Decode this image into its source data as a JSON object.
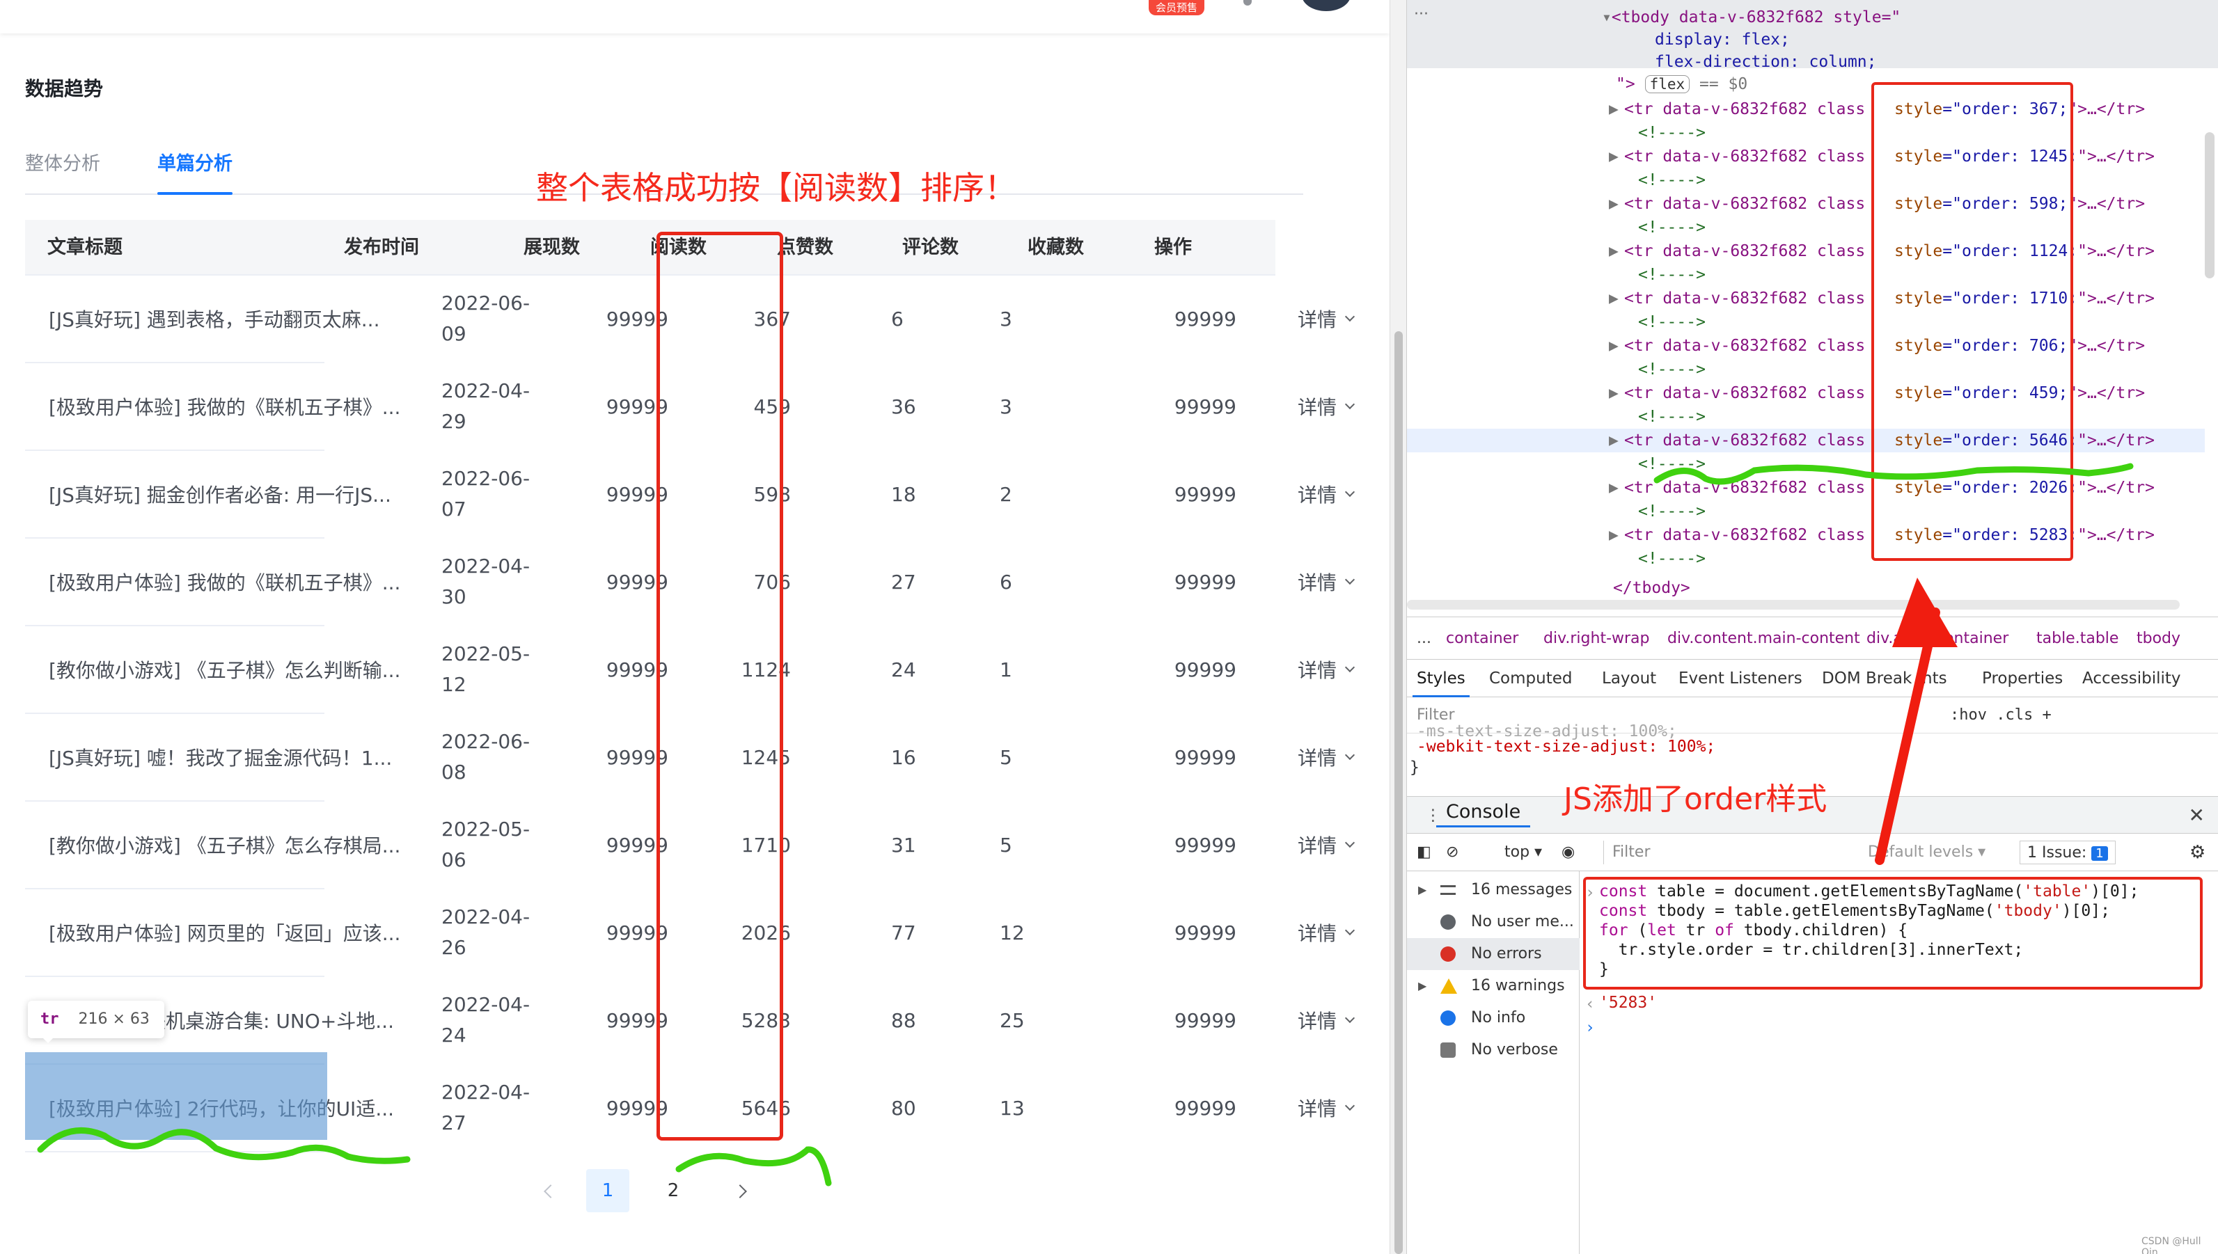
{
  "topbar": {
    "member_badge": "会员预售"
  },
  "section_title": "数据趋势",
  "tabs": [
    {
      "label": "整体分析",
      "active": false
    },
    {
      "label": "单篇分析",
      "active": true
    }
  ],
  "annotations": {
    "table_sorted": "整个表格成功按【阅读数】排序！",
    "js_added_order": "JS添加了order样式"
  },
  "table": {
    "headers": [
      "文章标题",
      "发布时间",
      "展现数",
      "阅读数",
      "点赞数",
      "评论数",
      "收藏数",
      "操作"
    ],
    "rows": [
      {
        "title": "[JS真好玩] 遇到表格，手动翻页太麻...",
        "date": "2022-06-09",
        "views": "99999",
        "reads": "367",
        "likes": "6",
        "comments": "3",
        "favs": "99999",
        "op": "详情"
      },
      {
        "title": "[极致用户体验] 我做的《联机五子棋》...",
        "date": "2022-04-29",
        "views": "99999",
        "reads": "459",
        "likes": "36",
        "comments": "3",
        "favs": "99999",
        "op": "详情"
      },
      {
        "title": "[JS真好玩] 掘金创作者必备: 用一行JS...",
        "date": "2022-06-07",
        "views": "99999",
        "reads": "598",
        "likes": "18",
        "comments": "2",
        "favs": "99999",
        "op": "详情"
      },
      {
        "title": "[极致用户体验] 我做的《联机五子棋》...",
        "date": "2022-04-30",
        "views": "99999",
        "reads": "706",
        "likes": "27",
        "comments": "6",
        "favs": "99999",
        "op": "详情"
      },
      {
        "title": "[教你做小游戏] 《五子棋》怎么判断输...",
        "date": "2022-05-12",
        "views": "99999",
        "reads": "1124",
        "likes": "24",
        "comments": "1",
        "favs": "99999",
        "op": "详情"
      },
      {
        "title": "[JS真好玩] 嘘！我改了掘金源代码！1...",
        "date": "2022-06-08",
        "views": "99999",
        "reads": "1245",
        "likes": "16",
        "comments": "5",
        "favs": "99999",
        "op": "详情"
      },
      {
        "title": "[教你做小游戏] 《五子棋》怎么存棋局...",
        "date": "2022-05-06",
        "views": "99999",
        "reads": "1710",
        "likes": "31",
        "comments": "5",
        "favs": "99999",
        "op": "详情"
      },
      {
        "title": "[极致用户体验] 网页里的「返回」应该...",
        "date": "2022-04-26",
        "views": "99999",
        "reads": "2026",
        "likes": "77",
        "comments": "12",
        "favs": "99999",
        "op": "详情"
      },
      {
        "title": "我做了个「联机桌游合集: UNO+斗地...",
        "date": "2022-04-24",
        "views": "99999",
        "reads": "5283",
        "likes": "88",
        "comments": "25",
        "favs": "99999",
        "op": "详情"
      },
      {
        "title": "[极致用户体验] 2行代码，让你的UI适...",
        "date": "2022-04-27",
        "views": "99999",
        "reads": "5646",
        "likes": "80",
        "comments": "13",
        "favs": "99999",
        "op": "详情"
      }
    ]
  },
  "tooltip": {
    "tag": "tr",
    "size": "216 × 63"
  },
  "pagination": {
    "pages": [
      "1",
      "2"
    ],
    "current": "1"
  },
  "devtools": {
    "elements": {
      "tbody_open": "<tbody data-v-6832f682 style=\"",
      "style_display": "display: flex;",
      "style_direction": "flex-direction: column;",
      "style_close": "\">",
      "flex_badge": "flex",
      "eq_dollar": "== $0",
      "tr_prefix": "<tr data-v-6832f682 class",
      "comment": "<!---->",
      "tr_suffix": "\">…</tr>",
      "orders": [
        "367",
        "1245",
        "598",
        "1124",
        "1710",
        "706",
        "459",
        "5646",
        "2026",
        "5283"
      ],
      "tbody_close": "</tbody>"
    },
    "breadcrumbs": [
      "...",
      "container",
      "div.right-wrap",
      "div.content.main-content",
      "div.alo",
      "container",
      "table.table",
      "tbody"
    ],
    "panel_tabs": [
      "Styles",
      "Computed",
      "Layout",
      "Event Listeners",
      "DOM Break",
      "nts",
      "Properties",
      "Accessibility"
    ],
    "styles_filter_placeholder": "Filter",
    "styles_tools": ":hov  .cls  +",
    "style_rule_faded": "-ms-text-size-adjust: 100%;",
    "style_rule": "-webkit-text-size-adjust: 100%;",
    "style_brace": "}",
    "console_tab": "Console",
    "console_toolbar": {
      "context": "top",
      "filter_placeholder": "Filter",
      "levels": "Default levels",
      "issues_label": "1 Issue:",
      "issues_count": "1"
    },
    "sidebar": [
      {
        "label": "16 messages",
        "icon": "list-icon"
      },
      {
        "label": "No user me...",
        "icon": "user-icon"
      },
      {
        "label": "No errors",
        "icon": "error-icon"
      },
      {
        "label": "16 warnings",
        "icon": "warning-icon"
      },
      {
        "label": "No info",
        "icon": "info-icon"
      },
      {
        "label": "No verbose",
        "icon": "verbose-icon"
      }
    ],
    "code_lines": [
      "const table = document.getElementsByTagName('table')[0];",
      "const tbody = table.getElementsByTagName('tbody')[0];",
      "for (let tr of tbody.children) {",
      "  tr.style.order = tr.children[3].innerText;",
      "}"
    ],
    "result": "'5283'"
  },
  "watermark": "CSDN @Hull Qin",
  "colors": {
    "accent": "#1677ff",
    "annotation_red": "#f5291c",
    "scribble_green": "#3fd20f",
    "row_highlight": "#5e98d4"
  }
}
